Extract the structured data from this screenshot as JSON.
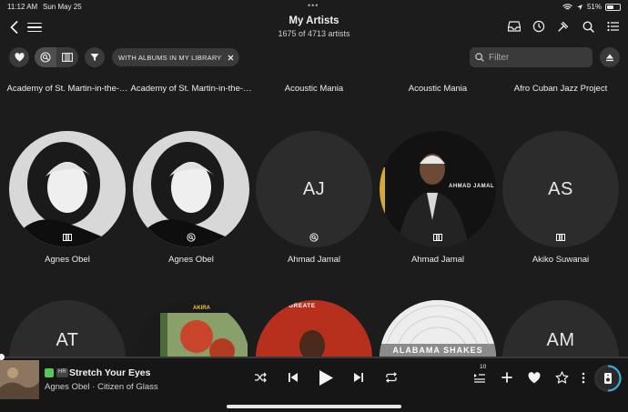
{
  "status": {
    "time": "11:12 AM",
    "date": "Sun May 25",
    "battery": "51%",
    "battery_level": 0.51
  },
  "header": {
    "title": "My Artists",
    "subtitle": "1675 of 4713 artists"
  },
  "filters": {
    "chip_label": "WITH ALBUMS IN MY LIBRARY",
    "search_placeholder": "Filter"
  },
  "top_row": [
    "Academy of St. Martin-in-the-…",
    "Academy of St. Martin-in-the-…",
    "Acoustic Mania",
    "Acoustic Mania",
    "Afro Cuban Jazz Project"
  ],
  "row1": [
    {
      "name": "Agnes Obel",
      "initials": "",
      "badge": "library-icon"
    },
    {
      "name": "Agnes Obel",
      "initials": "",
      "badge": "search-badge-icon"
    },
    {
      "name": "Ahmad Jamal",
      "initials": "AJ",
      "badge": "search-badge-icon"
    },
    {
      "name": "Ahmad Jamal",
      "initials": "",
      "badge": "library-icon",
      "cover_text": "AHMAD JAMAL"
    },
    {
      "name": "Akiko Suwanai",
      "initials": "AS",
      "badge": "library-icon"
    }
  ],
  "row2": [
    {
      "initials": "AT"
    },
    {
      "cover_text": "AKIRA"
    },
    {
      "cover_text": "GREATE"
    },
    {
      "cover_text": "ALABAMA SHAKES"
    },
    {
      "initials": "AM"
    }
  ],
  "player": {
    "track": "Stretch Your Eyes",
    "artist_album": "Agnes Obel · Citizen of Glass",
    "queue_count": "10",
    "badge": "HR",
    "progress": 0.0
  },
  "colors": {
    "background": "#1c1c1c",
    "surface": "#3a3a3a",
    "accent_green": "#57c65a",
    "accent_cyan": "#33b5e5"
  }
}
